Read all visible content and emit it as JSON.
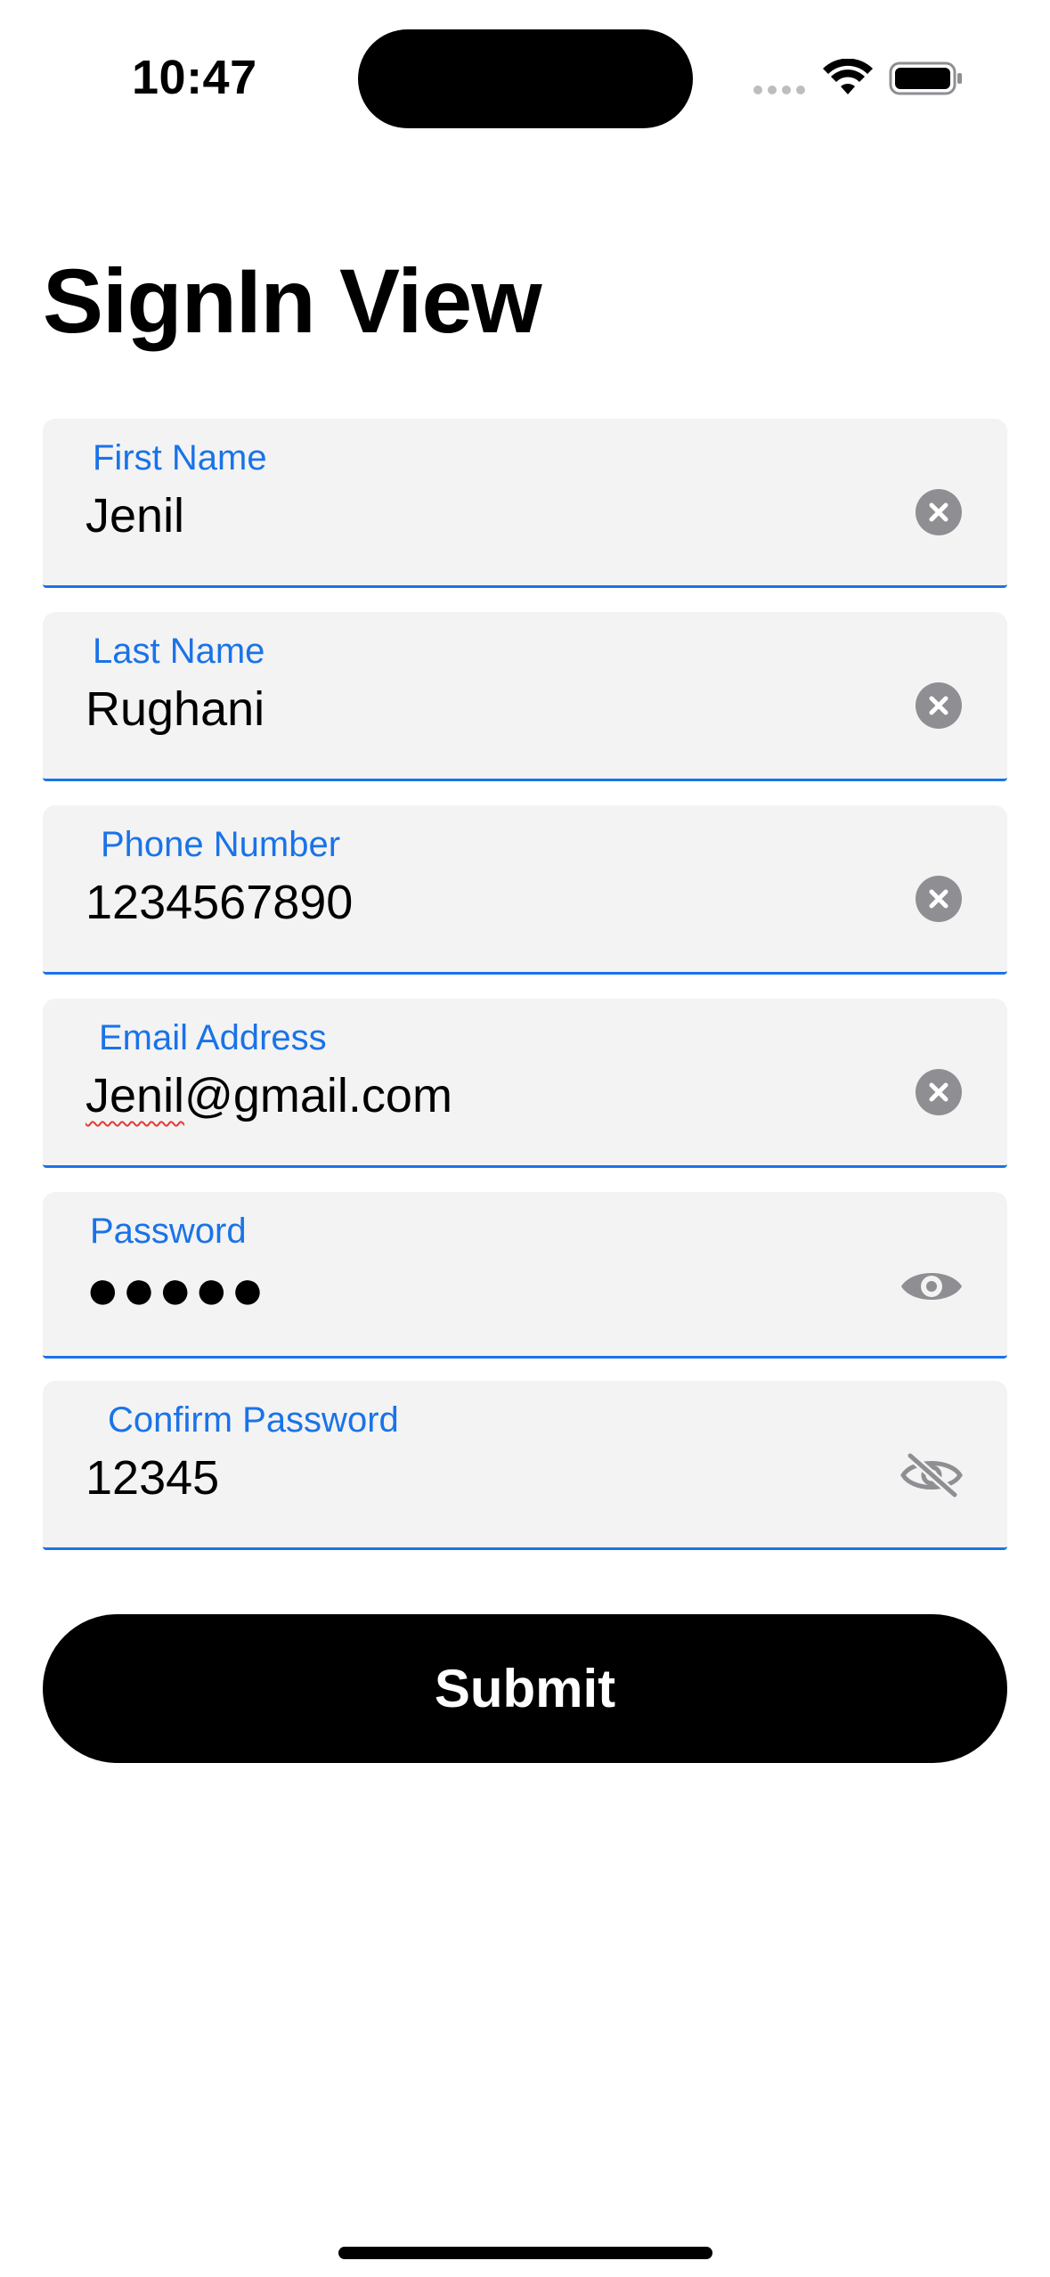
{
  "status_bar": {
    "time": "10:47"
  },
  "page": {
    "title": "SignIn View"
  },
  "fields": {
    "first_name": {
      "label": "First Name",
      "value": "Jenil"
    },
    "last_name": {
      "label": "Last Name",
      "value": "Rughani"
    },
    "phone_number": {
      "label": "Phone Number",
      "value": "1234567890"
    },
    "email": {
      "label": "Email Address",
      "value_misspelled": "Jenil",
      "value_rest": "@gmail.com"
    },
    "password": {
      "label": "Password",
      "value": "●●●●●",
      "toggle_icon": "eye-icon"
    },
    "confirm_password": {
      "label": "Confirm Password",
      "value": "12345",
      "toggle_icon": "eye-slash-icon"
    }
  },
  "submit": {
    "label": "Submit"
  },
  "colors": {
    "accent": "#1a73e8",
    "field_background": "#f3f3f3",
    "clear_icon": "#8e8e93",
    "button_background": "#000000",
    "button_text": "#ffffff"
  }
}
